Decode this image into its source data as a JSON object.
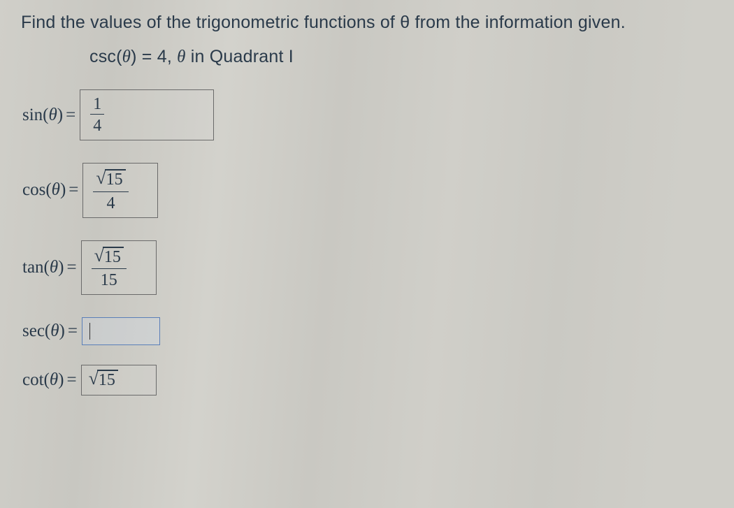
{
  "prompt": "Find the values of the trigonometric functions of θ from the information given.",
  "given_prefix": "csc(",
  "given_var": "θ",
  "given_after_var": ") = 4,  ",
  "given_var2": "θ",
  "given_suffix": " in Quadrant I",
  "rows": {
    "sin": {
      "label_prefix": "sin(",
      "var": "θ",
      "label_suffix": ")",
      "answer": {
        "num": "1",
        "den": "4"
      }
    },
    "cos": {
      "label_prefix": "cos(",
      "var": "θ",
      "label_suffix": ")",
      "answer": {
        "num_sqrt": "15",
        "den": "4"
      }
    },
    "tan": {
      "label_prefix": "tan(",
      "var": "θ",
      "label_suffix": ")",
      "answer": {
        "num_sqrt": "15",
        "den": "15"
      }
    },
    "sec": {
      "label_prefix": "sec(",
      "var": "θ",
      "label_suffix": ")",
      "answer": ""
    },
    "cot": {
      "label_prefix": "cot(",
      "var": "θ",
      "label_suffix": ")",
      "answer_sqrt": "15"
    }
  }
}
